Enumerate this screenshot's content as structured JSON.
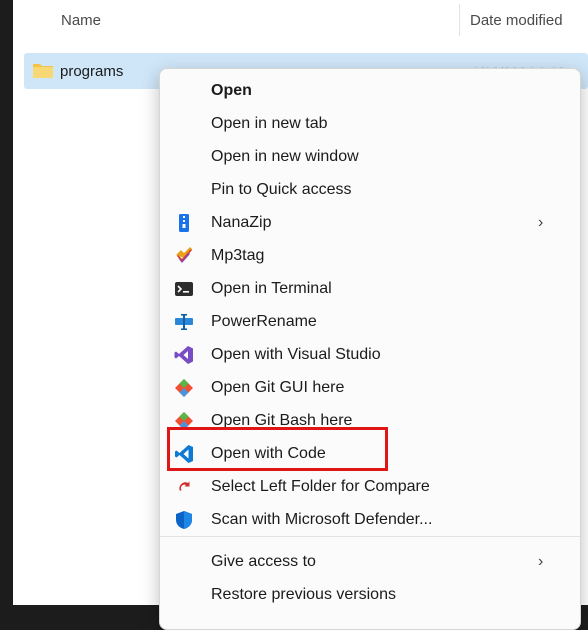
{
  "header": {
    "name_column": "Name",
    "date_column": "Date modified"
  },
  "file_row": {
    "name": "programs",
    "date_partial": "1/10/2024 1:13"
  },
  "menu": {
    "items": [
      {
        "label": "Open",
        "icon": "none",
        "bold": true
      },
      {
        "label": "Open in new tab",
        "icon": "none"
      },
      {
        "label": "Open in new window",
        "icon": "none"
      },
      {
        "label": "Pin to Quick access",
        "icon": "none"
      },
      {
        "label": "NanaZip",
        "icon": "nanazip-icon",
        "submenu": true
      },
      {
        "label": "Mp3tag",
        "icon": "mp3tag-icon"
      },
      {
        "label": "Open in Terminal",
        "icon": "terminal-icon"
      },
      {
        "label": "PowerRename",
        "icon": "powerrename-icon"
      },
      {
        "label": "Open with Visual Studio",
        "icon": "visual-studio-icon"
      },
      {
        "label": "Open Git GUI here",
        "icon": "git-gui-icon"
      },
      {
        "label": "Open Git Bash here",
        "icon": "git-bash-icon"
      },
      {
        "label": "Open with Code",
        "icon": "vscode-icon"
      },
      {
        "label": "Select Left Folder for Compare",
        "icon": "compare-icon"
      },
      {
        "label": "Scan with Microsoft Defender...",
        "icon": "defender-icon"
      },
      {
        "label": "Give access to",
        "icon": "none",
        "submenu": true
      },
      {
        "label": "Restore previous versions",
        "icon": "none"
      }
    ],
    "submenu_arrow": "›"
  },
  "colors": {
    "selection": "#cfe6f8",
    "highlight_border": "#e01515",
    "folder": "#f4c34a",
    "vscode": "#0e7ad1",
    "visual_studio": "#7a4cc4",
    "git": "#f05133"
  }
}
